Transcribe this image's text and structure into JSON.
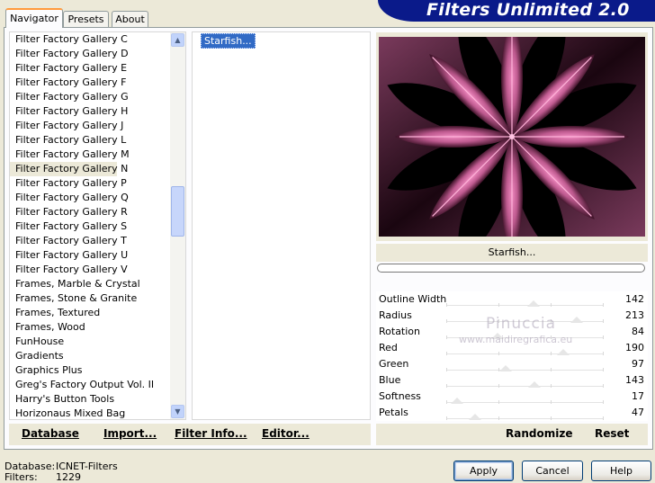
{
  "app": {
    "title": "Filters Unlimited 2.0"
  },
  "tabs": [
    {
      "label": "Navigator",
      "active": true
    },
    {
      "label": "Presets",
      "active": false
    },
    {
      "label": "About",
      "active": false
    }
  ],
  "categories": {
    "items": [
      "Filter Factory Gallery C",
      "Filter Factory Gallery D",
      "Filter Factory Gallery E",
      "Filter Factory Gallery F",
      "Filter Factory Gallery G",
      "Filter Factory Gallery H",
      "Filter Factory Gallery J",
      "Filter Factory Gallery L",
      "Filter Factory Gallery M",
      "Filter Factory Gallery N",
      "Filter Factory Gallery P",
      "Filter Factory Gallery Q",
      "Filter Factory Gallery R",
      "Filter Factory Gallery S",
      "Filter Factory Gallery T",
      "Filter Factory Gallery U",
      "Filter Factory Gallery V",
      "Frames, Marble & Crystal",
      "Frames, Stone & Granite",
      "Frames, Textured",
      "Frames, Wood",
      "FunHouse",
      "Gradients",
      "Graphics Plus",
      "Greg's Factory Output Vol. II",
      "Harry's Button Tools",
      "Horizonaus Mixed Bag"
    ],
    "selected": "Filter Factory Gallery N",
    "scroll_position": 0.45
  },
  "filters": {
    "selected": "Starfish..."
  },
  "list_buttons": {
    "database": "Database",
    "import": "Import...",
    "filter_info": "Filter Info...",
    "editor": "Editor..."
  },
  "preview": {
    "filter_name": "Starfish...",
    "progress": 0,
    "colors": {
      "background": "#000000",
      "petal": "#be5a8f",
      "petal_light": "#f08ac0"
    }
  },
  "parameters": [
    {
      "label": "Outline Width",
      "value": "142",
      "level": 0.557
    },
    {
      "label": "Radius",
      "value": "213",
      "level": 0.835
    },
    {
      "label": "Rotation",
      "value": "84",
      "level": 0.329
    },
    {
      "label": "Red",
      "value": "190",
      "level": 0.745
    },
    {
      "label": "Green",
      "value": "97",
      "level": 0.38
    },
    {
      "label": "Blue",
      "value": "143",
      "level": 0.561
    },
    {
      "label": "Softness",
      "value": "17",
      "level": 0.067
    },
    {
      "label": "Petals",
      "value": "47",
      "level": 0.184
    }
  ],
  "watermark": {
    "line1": "Pinuccia",
    "line2": "www.maidiregrafica.eu"
  },
  "param_buttons": {
    "randomize": "Randomize",
    "reset": "Reset"
  },
  "status": {
    "database_label": "Database:",
    "database_value": "ICNET-Filters",
    "filters_label": "Filters:",
    "filters_value": "1229"
  },
  "footer": {
    "apply": "Apply",
    "cancel": "Cancel",
    "help": "Help"
  }
}
